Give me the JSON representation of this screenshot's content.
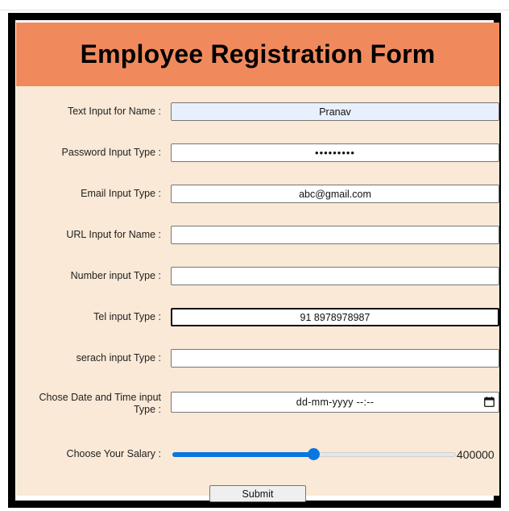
{
  "form": {
    "title": "Employee Registration Form",
    "fields": {
      "name": {
        "label": "Text Input for Name :",
        "value": "Pranav"
      },
      "password": {
        "label": "Password Input Type :",
        "value": "•••••••••"
      },
      "email": {
        "label": "Email Input Type :",
        "value": "abc@gmail.com"
      },
      "url": {
        "label": "URL Input for Name :",
        "value": ""
      },
      "number": {
        "label": "Number input Type :",
        "value": ""
      },
      "tel": {
        "label": "Tel input Type :",
        "value": "91 8978978987"
      },
      "search": {
        "label": "serach input Type :",
        "value": ""
      },
      "datetime": {
        "label": "Chose Date and Time input Type :",
        "placeholder": "dd-mm-yyyy  --:--"
      },
      "salary": {
        "label": "Choose Your Salary :",
        "value": "400000",
        "fraction": 0.5
      }
    },
    "submit_label": "Submit"
  },
  "colors": {
    "header_bg": "#f08a5d",
    "form_bg": "#f9e9d6",
    "frame_border": "#000000",
    "slider_accent": "#0b75e0",
    "autofill_bg": "#e8f0fe"
  },
  "icons": {
    "calendar": "calendar-icon"
  }
}
